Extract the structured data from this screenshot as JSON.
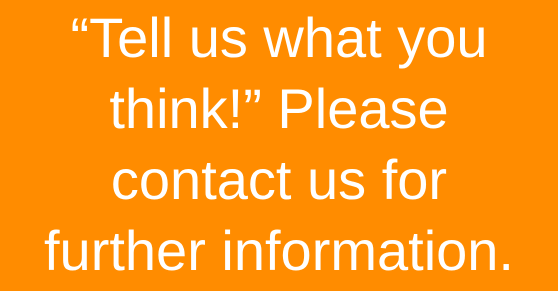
{
  "banner": {
    "background_color": "#FF8C00",
    "text_color": "#FFFFFF",
    "lines": [
      "“Tell us what you",
      "think!” Please",
      "contact us for",
      "further information."
    ]
  }
}
